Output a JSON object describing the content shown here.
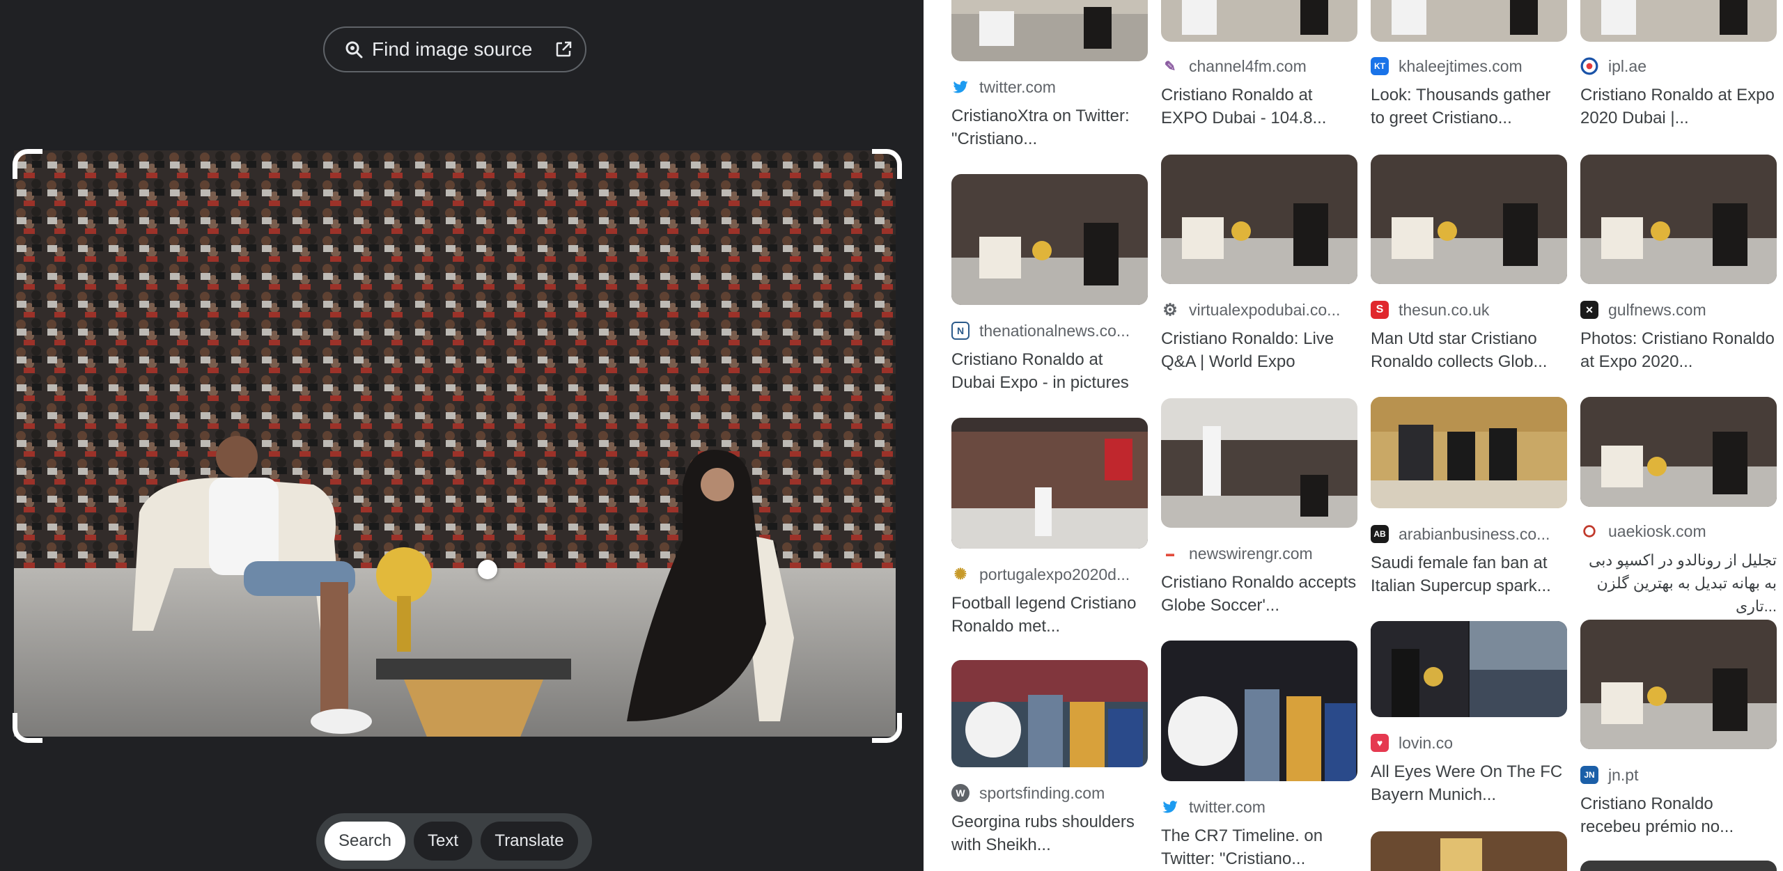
{
  "find_source": {
    "label": "Find image source",
    "icon_left": "lens-search-icon",
    "icon_right": "open-external-icon"
  },
  "modes": {
    "search": "Search",
    "text": "Text",
    "translate": "Translate",
    "active": "Search"
  },
  "results": [
    {
      "col": 0,
      "items": [
        {
          "source": "twitter.com",
          "fav_icon": "twitter-icon",
          "title": "CristianoXtra on Twitter: \"Cristiano..."
        },
        {
          "source": "thenationalnews.co...",
          "fav_icon": "thenationalnews-icon",
          "title": "Cristiano Ronaldo at Dubai Expo - in pictures"
        },
        {
          "source": "portugalexpo2020d...",
          "fav_icon": "portugalexpo-icon",
          "title": "Football legend Cristiano Ronaldo met..."
        },
        {
          "source": "sportsfinding.com",
          "fav_icon": "wordpress-icon",
          "title": "Georgina rubs shoulders with Sheikh..."
        }
      ]
    },
    {
      "col": 1,
      "items": [
        {
          "source": "channel4fm.com",
          "fav_icon": "channel4fm-icon",
          "title": "Cristiano Ronaldo at EXPO Dubai - 104.8..."
        },
        {
          "source": "virtualexpodubai.co...",
          "fav_icon": "virtualexpo-icon",
          "title": "Cristiano Ronaldo: Live Q&A | World Expo"
        },
        {
          "source": "newswirengr.com",
          "fav_icon": "newswire-icon",
          "title": "Cristiano Ronaldo accepts Globe Soccer'..."
        },
        {
          "source": "twitter.com",
          "fav_icon": "twitter-icon",
          "title": "The CR7 Timeline. on Twitter: \"Cristiano..."
        }
      ]
    },
    {
      "col": 2,
      "items": [
        {
          "source": "khaleejtimes.com",
          "fav_icon": "khaleejtimes-icon",
          "title": "Look: Thousands gather to greet Cristiano..."
        },
        {
          "source": "thesun.co.uk",
          "fav_icon": "thesun-icon",
          "title": "Man Utd star Cristiano Ronaldo collects Glob..."
        },
        {
          "source": "arabianbusiness.co...",
          "fav_icon": "arabianbusiness-icon",
          "fav_text": "AB",
          "title": "Saudi female fan ban at Italian Supercup spark..."
        },
        {
          "source": "lovin.co",
          "fav_icon": "lovin-icon",
          "title": "All Eyes Were On The FC Bayern Munich..."
        }
      ]
    },
    {
      "col": 3,
      "items": [
        {
          "source": "ipl.ae",
          "fav_icon": "ipl-icon",
          "title": "Cristiano Ronaldo at Expo 2020 Dubai |..."
        },
        {
          "source": "gulfnews.com",
          "fav_icon": "gulfnews-icon",
          "title": "Photos: Cristiano Ronaldo at Expo 2020..."
        },
        {
          "source": "uaekiosk.com",
          "fav_icon": "uaekiosk-icon",
          "title": "تجلیل از رونالدو در اکسپو دبی به بهانه تبدیل به بهترین گلزن تاری..."
        },
        {
          "source": "jn.pt",
          "fav_icon": "jn-icon",
          "fav_text": "JN",
          "title": "Cristiano Ronaldo recebeu prémio no..."
        }
      ]
    }
  ],
  "colors": {
    "dark_bg": "#202124",
    "twitter": "#1d9bf0",
    "thesun": "#e0282d",
    "gulfnews": "#1a1a1a",
    "jn": "#1b5fa8",
    "lovin": "#e53950"
  }
}
